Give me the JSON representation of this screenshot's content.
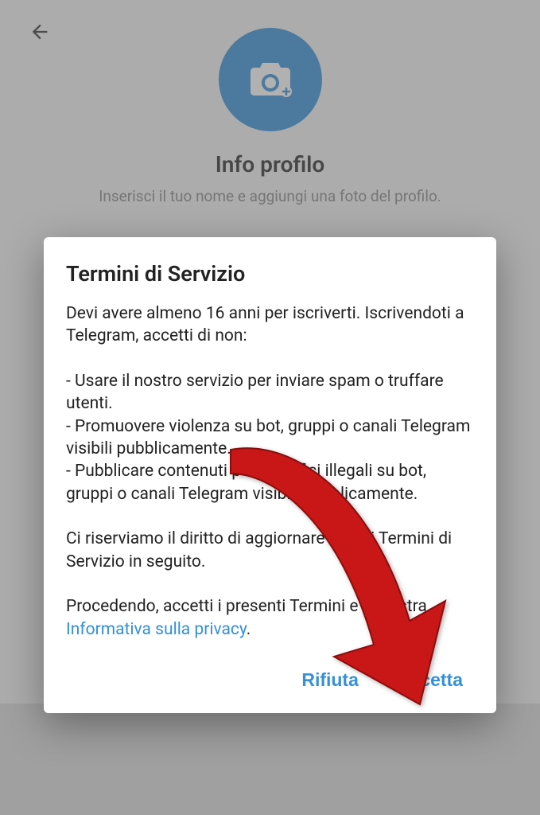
{
  "background": {
    "title": "Info profilo",
    "subtitle": "Inserisci il tuo nome e aggiungi una foto del profilo."
  },
  "dialog": {
    "title": "Termini di Servizio",
    "intro": "Devi avere almeno 16 anni per iscriverti. Iscrivendoti a Telegram, accetti di non:",
    "bullet1": "- Usare il nostro servizio per inviare spam o truffare utenti.",
    "bullet2": "- Promuovere violenza su bot, gruppi o canali Telegram visibili pubblicamente.",
    "bullet3": "- Pubblicare contenuti pornografici illegali su bot, gruppi o canali Telegram visibili pubblicamente.",
    "reserve": "Ci riserviamo il diritto di aggiornare questi Termini di Servizio in seguito.",
    "proceed_prefix": "Procedendo, accetti i presenti Termini e la nostra ",
    "privacy_link": "Informativa sulla privacy",
    "proceed_suffix": ".",
    "reject_label": "Rifiuta",
    "accept_label": "Accetta"
  }
}
